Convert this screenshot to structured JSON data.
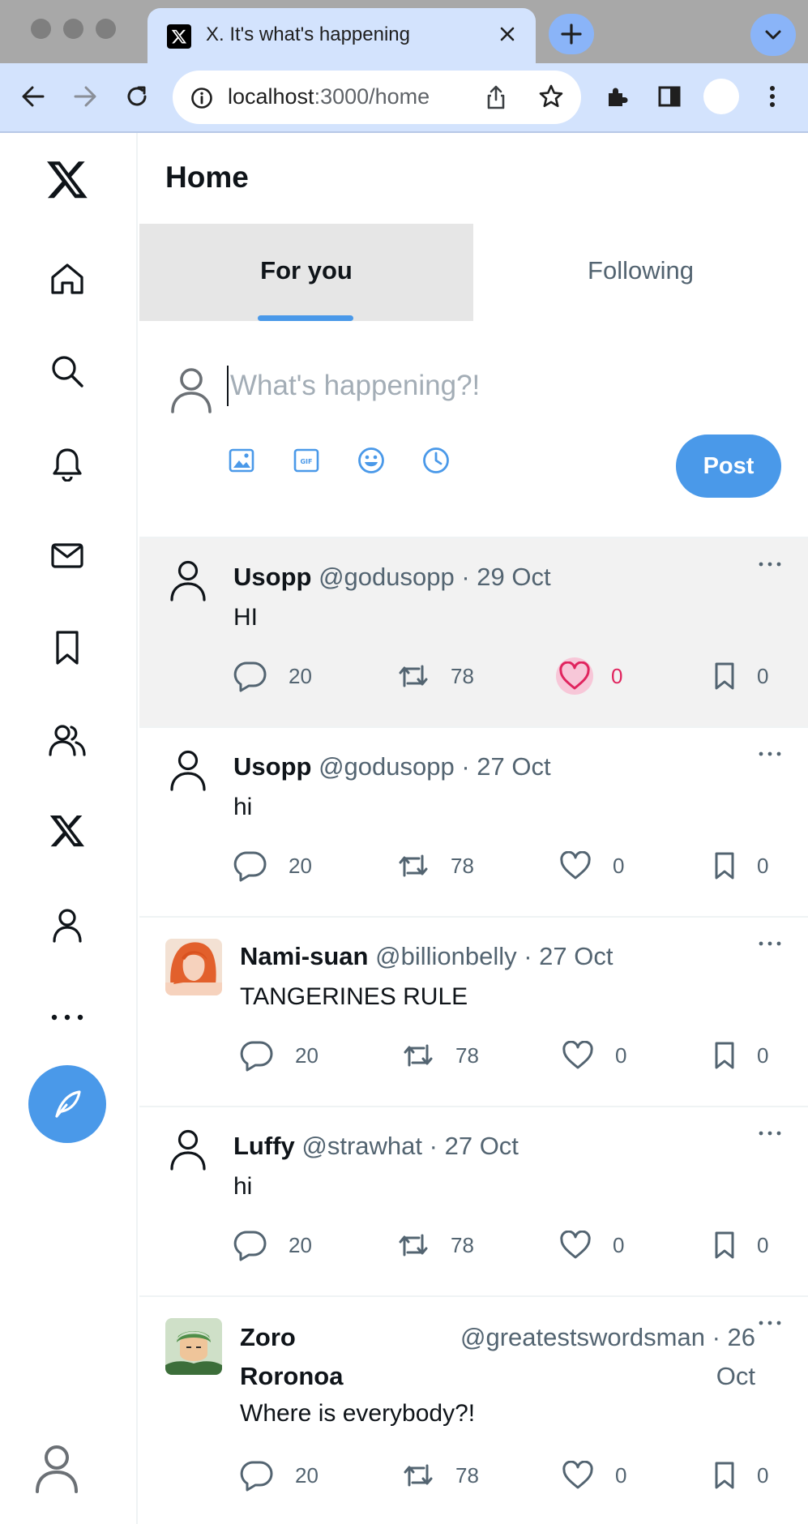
{
  "browser": {
    "tab_title": "X. It's what's happening",
    "url_host": "localhost",
    "url_path": ":3000/home"
  },
  "page": {
    "title": "Home",
    "tabs": [
      {
        "label": "For you",
        "active": true
      },
      {
        "label": "Following",
        "active": false
      }
    ],
    "composer": {
      "placeholder": "What's happening?!",
      "post_label": "Post"
    }
  },
  "sidebar": {
    "items": [
      "x-logo-icon",
      "home-icon",
      "search-icon",
      "bell-icon",
      "mail-icon",
      "bookmark-icon",
      "people-icon",
      "x-premium-icon",
      "profile-icon",
      "more-icon"
    ],
    "accent": "#4a99e9"
  },
  "tweets": [
    {
      "name": "Usopp",
      "handle": "@godusopp",
      "date": "29 Oct",
      "text": "HI",
      "replies": "20",
      "reposts": "78",
      "likes": "0",
      "bookmarks": "0",
      "liked": true,
      "avatar": "default"
    },
    {
      "name": "Usopp",
      "handle": "@godusopp",
      "date": "27 Oct",
      "text": "hi",
      "replies": "20",
      "reposts": "78",
      "likes": "0",
      "bookmarks": "0",
      "liked": false,
      "avatar": "default"
    },
    {
      "name": "Nami-suan",
      "handle": "@billionbelly",
      "date": "27 Oct",
      "text": "TANGERINES RULE",
      "replies": "20",
      "reposts": "78",
      "likes": "0",
      "bookmarks": "0",
      "liked": false,
      "avatar": "photo"
    },
    {
      "name": "Luffy",
      "handle": "@strawhat",
      "date": "27 Oct",
      "text": "hi",
      "replies": "20",
      "reposts": "78",
      "likes": "0",
      "bookmarks": "0",
      "liked": false,
      "avatar": "default"
    },
    {
      "name_line1": "Zoro",
      "name_line2": "Roronoa",
      "handle_line1": "@greatestswordsman · 26",
      "handle_line2": "Oct",
      "text": "Where is everybody?!",
      "replies": "20",
      "reposts": "78",
      "likes": "0",
      "bookmarks": "0",
      "liked": false,
      "avatar": "photo"
    }
  ],
  "colors": {
    "like_active": "#e0245e",
    "link_blue": "#4a99e9",
    "muted": "#536471"
  }
}
